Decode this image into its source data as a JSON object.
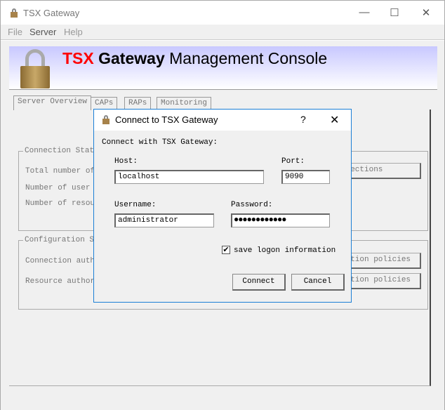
{
  "window": {
    "title": "TSX Gateway",
    "minimize": "—",
    "maximize": "☐",
    "close": "✕"
  },
  "menu": [
    "File",
    "Server",
    "Help"
  ],
  "banner": {
    "part1": "TSX",
    "part2": "Gateway",
    "part3": "Management Console",
    "accent": "#ff0000"
  },
  "tabs": [
    "Server Overview",
    "CAPs",
    "RAPs",
    "Monitoring"
  ],
  "connection_status": {
    "label": "Connection Statu",
    "rows": [
      "Total number of",
      "Number of user c",
      "Number of resour"
    ],
    "button": "nnections"
  },
  "configuration_status": {
    "label": "Configuration St",
    "rows": [
      "Connection author",
      "Resource authori"
    ],
    "buttons": [
      "zation policies",
      "ration policies"
    ]
  },
  "dialog": {
    "title": "Connect to TSX Gateway",
    "help": "?",
    "close": "✕",
    "heading": "Connect with TSX Gateway:",
    "host_label": "Host:",
    "host_value": "localhost",
    "port_label": "Port:",
    "port_value": "9090",
    "username_label": "Username:",
    "username_value": "administrator",
    "password_label": "Password:",
    "password_value": "●●●●●●●●●●●●",
    "save_logon": {
      "label": "save logon information",
      "checked": true,
      "mark": "✔"
    },
    "connect": "Connect",
    "cancel": "Cancel"
  }
}
